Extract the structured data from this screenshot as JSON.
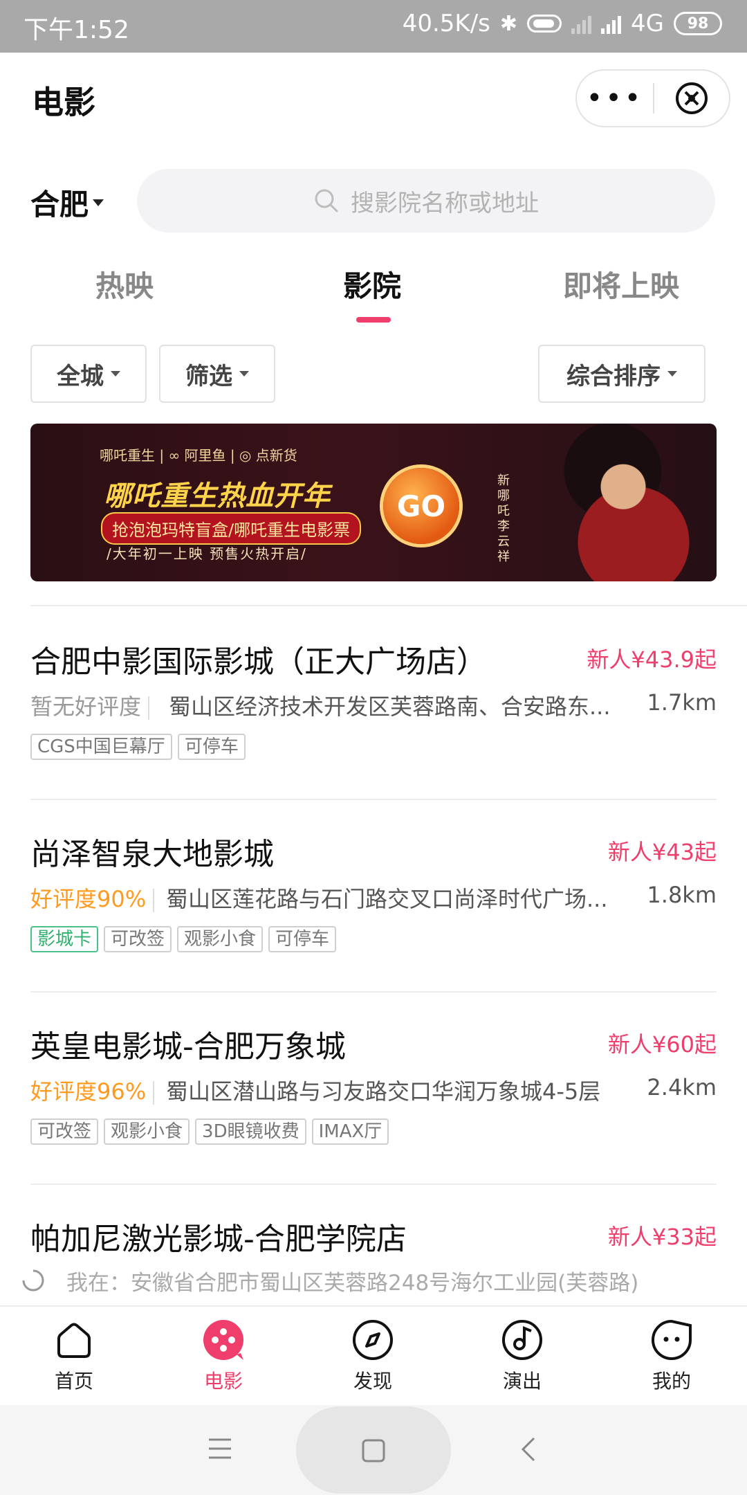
{
  "status_bar": {
    "time": "下午1:52",
    "net_speed": "40.5K/s",
    "network": "4G",
    "battery": "98"
  },
  "header": {
    "title": "电影",
    "more_label": "•••"
  },
  "city": "合肥",
  "search": {
    "placeholder": "搜影院名称或地址"
  },
  "tabs": [
    {
      "label": "热映",
      "active": false
    },
    {
      "label": "影院",
      "active": true
    },
    {
      "label": "即将上映",
      "active": false
    }
  ],
  "filters": {
    "area": "全城",
    "filter": "筛选",
    "sort": "综合排序"
  },
  "banner": {
    "brands": "哪吒重生 | ∞ 阿里鱼 | ◎ 点新货",
    "title": "哪吒重生热血开年",
    "subtitle": "抢泡泡玛特盲盒/哪吒重生电影票",
    "tagline": "/大年初一上映 预售火热开启/",
    "go": "GO",
    "vertical_text": "新哪吒 李云祥"
  },
  "cinemas": [
    {
      "name": "合肥中影国际影城（正大广场店）",
      "price": "新人¥43.9起",
      "rating": "暂无好评度",
      "address": "蜀山区经济技术开发区芙蓉路南、合安路东...",
      "distance": "1.7km",
      "tags": [
        "CGS中国巨幕厅",
        "可停车"
      ]
    },
    {
      "name": "尚泽智泉大地影城",
      "price": "新人¥43起",
      "rating": "好评度90%",
      "address": "蜀山区莲花路与石门路交叉口尚泽时代广场...",
      "distance": "1.8km",
      "tags": [
        "影城卡",
        "可改签",
        "观影小食",
        "可停车"
      ]
    },
    {
      "name": "英皇电影城-合肥万象城",
      "price": "新人¥60起",
      "rating": "好评度96%",
      "address": "蜀山区潜山路与习友路交口华润万象城4-5层",
      "distance": "2.4km",
      "tags": [
        "可改签",
        "观影小食",
        "3D眼镜收费",
        "IMAX厅"
      ]
    },
    {
      "name": "帕加尼激光影城-合肥学院店",
      "price": "新人¥33起"
    }
  ],
  "location": {
    "text": "我在：安徽省合肥市蜀山区芙蓉路248号海尔工业园(芙蓉路)"
  },
  "bottom_nav": [
    {
      "label": "首页",
      "icon": "home-icon",
      "active": false
    },
    {
      "label": "电影",
      "icon": "movie-icon",
      "active": true
    },
    {
      "label": "发现",
      "icon": "compass-icon",
      "active": false
    },
    {
      "label": "演出",
      "icon": "music-note-icon",
      "active": false
    },
    {
      "label": "我的",
      "icon": "profile-face-icon",
      "active": false
    }
  ],
  "colors": {
    "accent": "#ef3e6c",
    "rating_good": "#ff9a1e",
    "tag_green": "#2fb06f",
    "status_bar": "#a9a9a9"
  }
}
